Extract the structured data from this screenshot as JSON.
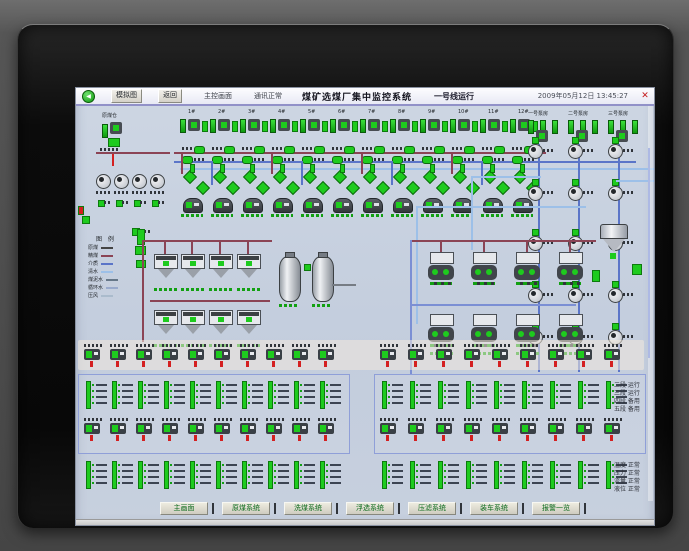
{
  "titlebar": {
    "back_glyph": "◀",
    "buttons": [
      "模拟图",
      "返回"
    ],
    "status_texts": [
      "主控画面",
      "通讯正常"
    ],
    "title": "煤矿选煤厂集中监控系统",
    "subtitle": "一号线运行",
    "datetime": "2009年05月12日 13:45:27",
    "close_glyph": "✕"
  },
  "top_left": {
    "label": "原煤仓",
    "pump_count": 4
  },
  "conveyors": {
    "column_labels": [
      "1#",
      "2#",
      "3#",
      "4#",
      "5#",
      "6#",
      "7#",
      "8#",
      "9#",
      "10#",
      "11#",
      "12#"
    ]
  },
  "pump_station": {
    "headers": [
      "一号泵房",
      "二号泵房",
      "三号泵房"
    ],
    "units_per_column": 5
  },
  "legend": {
    "title": "图 例",
    "items": [
      {
        "label": "原煤",
        "color": "#444444"
      },
      {
        "label": "精煤",
        "color": "#8b4455"
      },
      {
        "label": "介质",
        "color": "#5b75c8"
      },
      {
        "label": "清水",
        "color": "#9dc0e8"
      },
      {
        "label": "煤泥水",
        "color": "#667788"
      },
      {
        "label": "循环水",
        "color": "#99aacc"
      },
      {
        "label": "压风",
        "color": "#aabbcc"
      }
    ]
  },
  "process": {
    "left_machines_row1": 4,
    "left_machines_row2": 4,
    "tanks": 2,
    "right_machines_row1": 4,
    "right_machines_row2": 4
  },
  "panels": {
    "left_columns": 10,
    "right_columns": 9,
    "status_lines_per_unit": 4
  },
  "side_notes": {
    "upper": [
      "二段 运行",
      "三段 运行",
      "四段 备用",
      "五段 备用"
    ],
    "lower": [
      "温度 正常",
      "压力 正常",
      "流量 正常",
      "液位 正常"
    ]
  },
  "nav": {
    "buttons": [
      "主画面",
      "原煤系统",
      "洗煤系统",
      "浮选系统",
      "压滤系统",
      "装车系统",
      "报警一览"
    ]
  },
  "colors": {
    "screen_bg": "#c6d0df",
    "green": "#1ecb1e",
    "maroon": "#8b4455",
    "blue": "#5b75c8",
    "light_blue": "#9dc0e8",
    "periwinkle": "#7b8fd4",
    "panel_border": "#8f9fd8",
    "red": "#d42020",
    "gray_pipe": "#767c84"
  }
}
